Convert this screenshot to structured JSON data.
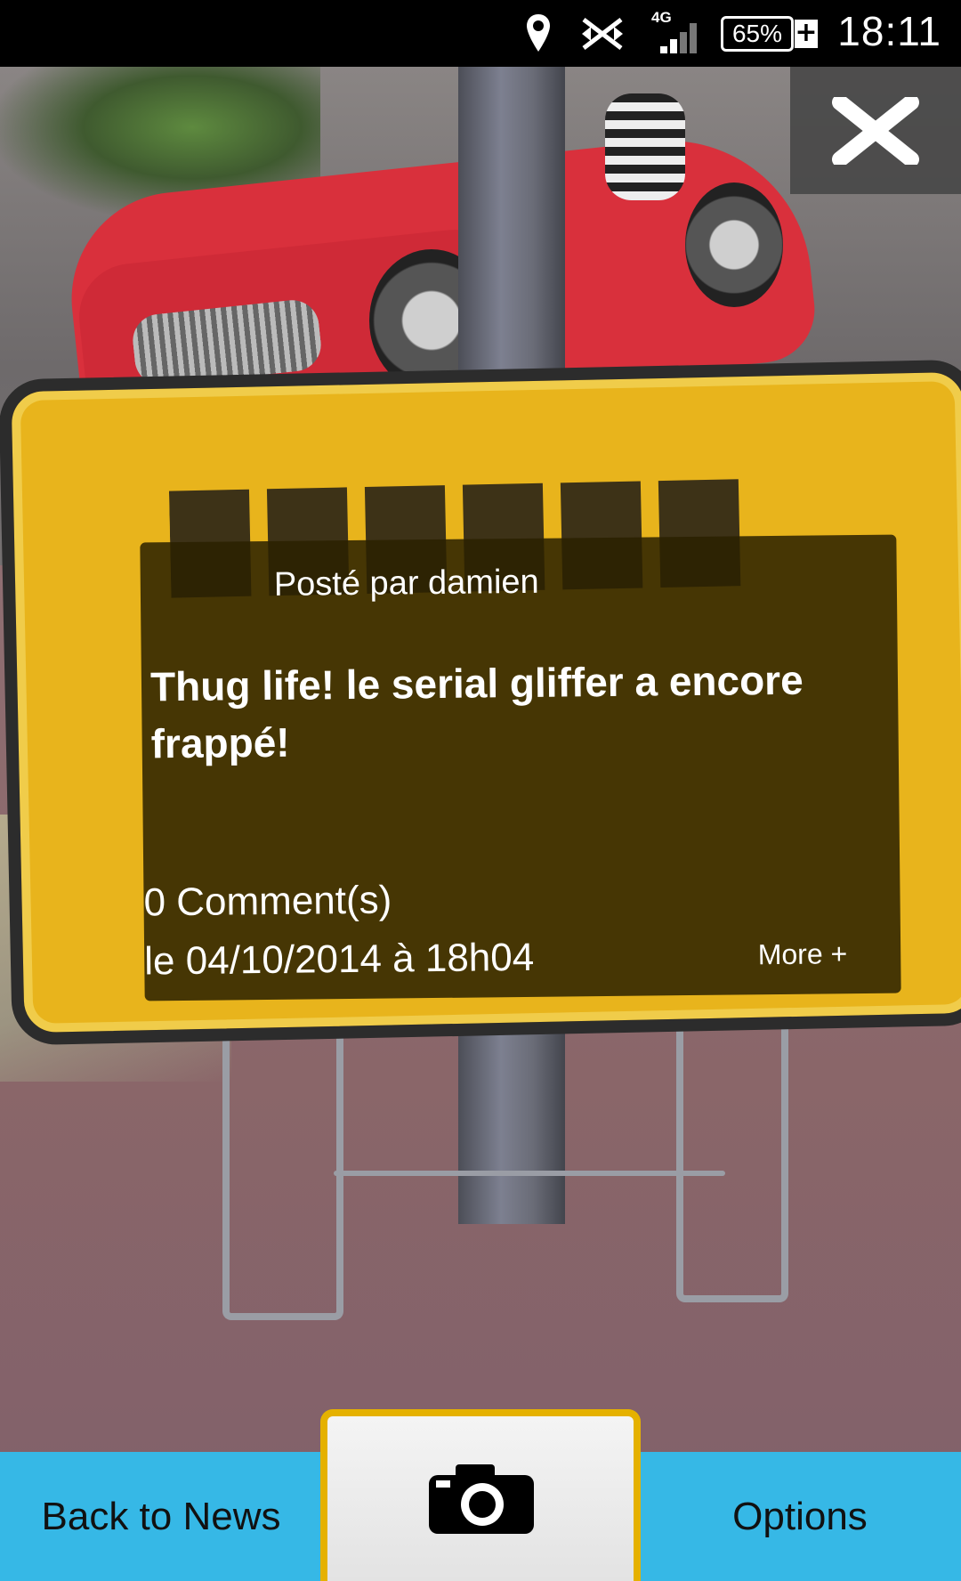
{
  "status_bar": {
    "time": "18:11",
    "battery": "65%",
    "battery_charging": "+",
    "network": "4G",
    "icons": [
      "location-icon",
      "sync-off-icon",
      "signal-icon",
      "battery-icon"
    ]
  },
  "close_button": {
    "icon": "close-icon"
  },
  "post": {
    "author_line": "Posté par damien",
    "title": "Thug life! le serial gliffer a encore frappé!",
    "comments": "0 Comment(s)",
    "date": "le 04/10/2014 à 18h04",
    "more": "More +"
  },
  "bottom_bar": {
    "back_label": "Back to News",
    "camera_icon": "camera-icon",
    "options_label": "Options",
    "accent": "#36b8e6",
    "camera_border": "#e5b100"
  }
}
